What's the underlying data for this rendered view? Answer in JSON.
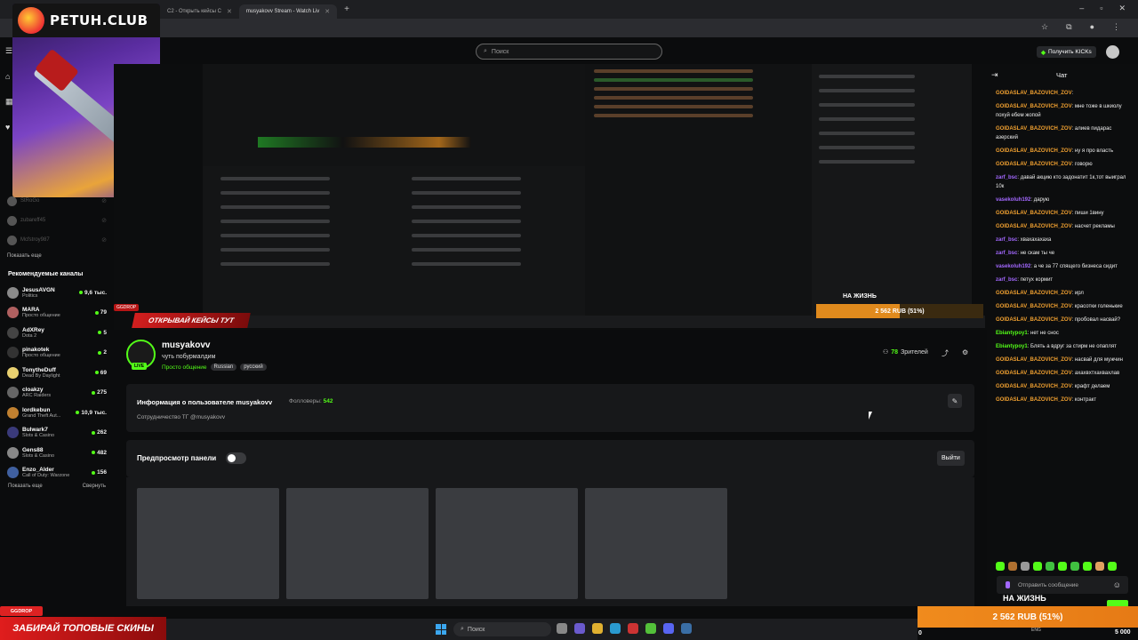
{
  "browser": {
    "tabs": [
      {
        "label": "C2 - Открыть кейсы C",
        "active": false
      },
      {
        "label": "musyakovv Stream - Watch Liv",
        "active": true
      }
    ]
  },
  "overlay": {
    "brand": "PETUH.CLUB",
    "open_cases_banner": "ОТКРЫВАЙ КЕЙСЫ ТУТ",
    "ggdrop_tag": "GGDROP",
    "bottom_banner": "ЗАБИРАЙ ТОПОВЫЕ СКИНЫ",
    "bottom_tag": "GGDROP"
  },
  "header": {
    "search_placeholder": "Поиск",
    "get_kicks": "Получить KICKs"
  },
  "sidebar": {
    "followed": [
      {
        "name": "StRoGo"
      },
      {
        "name": "zubareff45"
      },
      {
        "name": "Mcfstroy987"
      }
    ],
    "show_more": "Показать еще",
    "recommended_title": "Рекомендуемые каналы",
    "recommended": [
      {
        "name": "JesusAVGN",
        "category": "Politics",
        "viewers": "9,6 тыс.",
        "color": "#8a8a8a"
      },
      {
        "name": "MARA",
        "category": "Просто общение",
        "viewers": "79",
        "color": "#b06060"
      },
      {
        "name": "AdXRey",
        "category": "Dota 2",
        "viewers": "5",
        "color": "#444"
      },
      {
        "name": "pinakotek",
        "category": "Просто общение",
        "viewers": "2",
        "color": "#333"
      },
      {
        "name": "TonytheDuff",
        "category": "Dead By Daylight",
        "viewers": "69",
        "color": "#e8d070"
      },
      {
        "name": "cloakzy",
        "category": "ARC Raiders",
        "viewers": "275",
        "color": "#666"
      },
      {
        "name": "lordkebun",
        "category": "Grand Theft Aut...",
        "viewers": "10,9 тыс.",
        "color": "#c08030"
      },
      {
        "name": "Bulwark7",
        "category": "Slots & Casino",
        "viewers": "262",
        "color": "#3a3a7a"
      },
      {
        "name": "Gens88",
        "category": "Slots & Casino",
        "viewers": "482",
        "color": "#888"
      },
      {
        "name": "Enzo_Alder",
        "category": "Call of Duty: Warzone",
        "viewers": "156",
        "color": "#4060a0"
      }
    ],
    "show_more_2": "Показать еще",
    "collapse": "Свернуть"
  },
  "video": {
    "life_label": "НА ЖИЗНЬ",
    "goal_bar": "2 562 RUB (51%)",
    "goal_fraction": 0.51
  },
  "channel": {
    "name": "musyakovv",
    "live": "LIVE",
    "title": "чуть побурмалдим",
    "category": "Просто общение",
    "tags": [
      "Russian",
      "русский"
    ],
    "viewers": "78",
    "viewers_label": "Зрителей"
  },
  "about": {
    "title": "Информация о пользователе musyakovv",
    "followers_label": "Фолловеры:",
    "followers": "542",
    "description": "Сотрудничество ТГ @musyakovv"
  },
  "panel_preview": {
    "label": "Предпросмотр панели",
    "exit": "Выйти"
  },
  "chat": {
    "title": "Чат",
    "messages": [
      {
        "user": "GOIDASLAV_BAZOVICH_ZOV",
        "text": "",
        "color": "#f0a030"
      },
      {
        "user": "GOIDASLAV_BAZOVICH_ZOV",
        "text": "мне тоже в шкиолу похуй ебем жопой",
        "color": "#f0a030"
      },
      {
        "user": "GOIDASLAV_BAZOVICH_ZOV",
        "text": "алиев пидарас азерский",
        "color": "#f0a030"
      },
      {
        "user": "GOIDASLAV_BAZOVICH_ZOV",
        "text": "ну я про власть",
        "color": "#f0a030"
      },
      {
        "user": "GOIDASLAV_BAZOVICH_ZOV",
        "text": "говорю",
        "color": "#f0a030"
      },
      {
        "user": "zarf_bsc",
        "text": "давай акцию кто задонатит 1к,тот выиграл 10к",
        "color": "#a368ff"
      },
      {
        "user": "vasekoluh192",
        "text": "дарую",
        "color": "#a368ff"
      },
      {
        "user": "GOIDASLAV_BAZOVICH_ZOV",
        "text": "пиши 1винy",
        "color": "#f0a030"
      },
      {
        "user": "GOIDASLAV_BAZOVICH_ZOV",
        "text": "насчет рекламы",
        "color": "#f0a030"
      },
      {
        "user": "zarf_bsc",
        "text": "хвахахахаха",
        "color": "#a368ff"
      },
      {
        "user": "zarf_bsc",
        "text": "не скам ты че",
        "color": "#a368ff"
      },
      {
        "user": "vasekoluh192",
        "text": "а че за 77 спящего бизнеса сидит",
        "color": "#a368ff"
      },
      {
        "user": "zarf_bsc",
        "text": "петух кормит",
        "color": "#a368ff"
      },
      {
        "user": "GOIDASLAV_BAZOVICH_ZOV",
        "text": "ирл",
        "color": "#f0a030"
      },
      {
        "user": "GOIDASLAV_BAZOVICH_ZOV",
        "text": "красотки голенькие",
        "color": "#f0a030"
      },
      {
        "user": "GOIDASLAV_BAZOVICH_ZOV",
        "text": "пробовал насвай?",
        "color": "#f0a030"
      },
      {
        "user": "Ebiantypoy1",
        "text": "нет не снос",
        "color": "#53fc18"
      },
      {
        "user": "Ebiantypoy1",
        "text": "Блять а вдруг за стирм не опаплят",
        "color": "#53fc18"
      },
      {
        "user": "GOIDASLAV_BAZOVICH_ZOV",
        "text": "насвай для мужчин",
        "color": "#f0a030"
      },
      {
        "user": "GOIDASLAV_BAZOVICH_ZOV",
        "text": "ахахвхтхахвахлав",
        "color": "#f0a030"
      },
      {
        "user": "GOIDASLAV_BAZOVICH_ZOV",
        "text": "крафт делаем",
        "color": "#f0a030"
      },
      {
        "user": "GOIDASLAV_BAZOVICH_ZOV",
        "text": "контракт",
        "color": "#f0a030"
      }
    ],
    "input_placeholder": "Отправить сообщение",
    "life_label": "НА ЖИЗНЬ",
    "goal_bar": "2 562 RUB (51%)",
    "goal_zero": "0",
    "goal_max": "5 000"
  },
  "taskbar": {
    "search": "Поиск",
    "lang": "ENG"
  }
}
